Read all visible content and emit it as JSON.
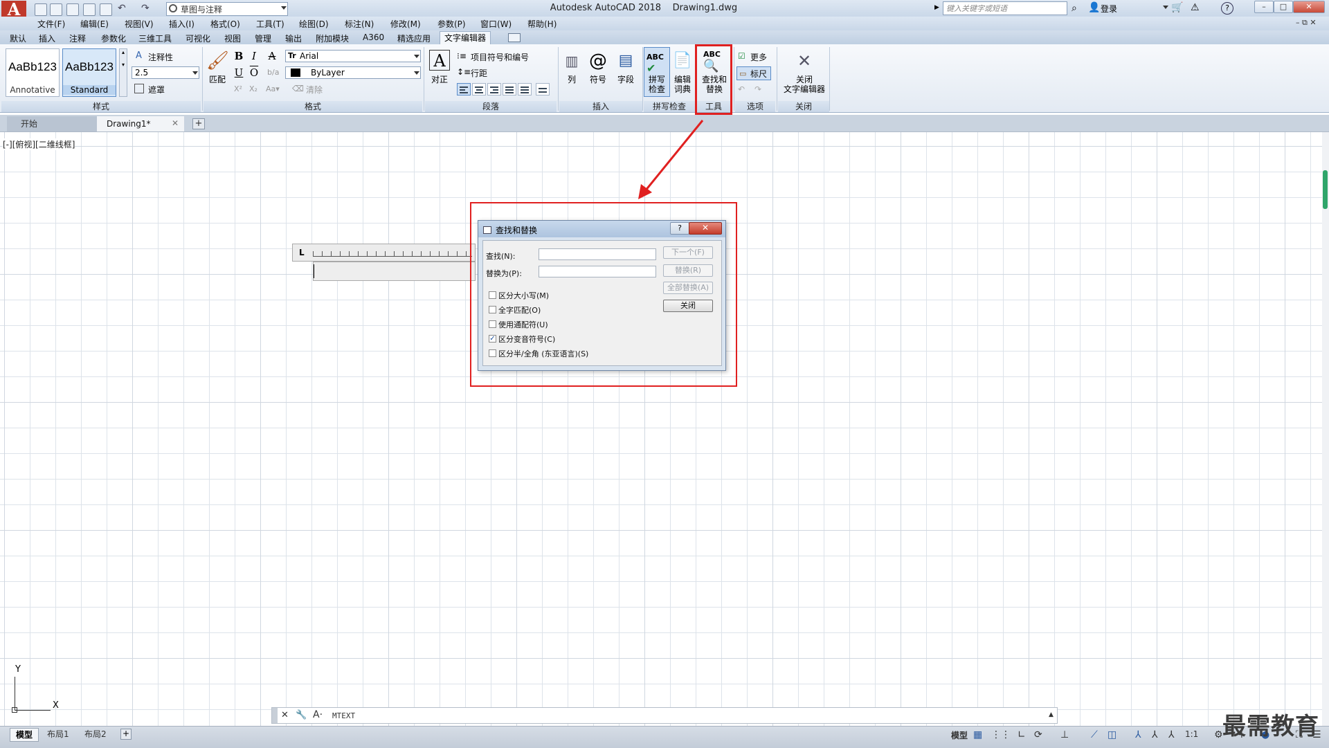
{
  "titlebar": {
    "workspace": "草图与注释",
    "app_title": "Autodesk AutoCAD 2018",
    "drawing_title": "Drawing1.dwg",
    "search_placeholder": "键入关键字或短语",
    "login_label": "登录",
    "help": "?"
  },
  "menu": [
    "文件(F)",
    "编辑(E)",
    "视图(V)",
    "插入(I)",
    "格式(O)",
    "工具(T)",
    "绘图(D)",
    "标注(N)",
    "修改(M)",
    "参数(P)",
    "窗口(W)",
    "帮助(H)"
  ],
  "ribbon_tabs": [
    "默认",
    "插入",
    "注释",
    "参数化",
    "三维工具",
    "可视化",
    "视图",
    "管理",
    "输出",
    "附加模块",
    "A360",
    "精选应用"
  ],
  "active_tab": "文字编辑器",
  "ribbon": {
    "style_panel": {
      "swatch1_text": "AaBb123",
      "swatch1_label": "Annotative",
      "swatch2_text": "AaBb123",
      "swatch2_label": "Standard",
      "annotative_label": "注释性",
      "text_height": "2.5",
      "mask_label": "遮罩",
      "title": "样式"
    },
    "format_panel": {
      "match_label": "匹配",
      "bold": "B",
      "italic": "I",
      "strike": "A",
      "underline": "U",
      "overline": "O",
      "font": "Arial",
      "color": "ByLayer",
      "clear_label": "清除",
      "title": "格式"
    },
    "paragraph_panel": {
      "justify_label": "对正",
      "bullets_label": "项目符号和编号",
      "line_spacing_label": "行距",
      "title": "段落"
    },
    "insert_panel": {
      "columns_label": "列",
      "symbol_label": "符号",
      "field_label": "字段",
      "title": "插入"
    },
    "spell_panel": {
      "spell_label_1": "拼写",
      "spell_label_2": "检查",
      "dict_label_1": "编辑",
      "dict_label_2": "词典",
      "title": "拼写检查"
    },
    "tools_panel": {
      "find_label_1": "查找和",
      "find_label_2": "替换",
      "title": "工具"
    },
    "options_panel": {
      "more_label": "更多",
      "ruler_label": "标尺",
      "title": "选项"
    },
    "close_panel": {
      "close_label_1": "关闭",
      "close_label_2": "文字编辑器",
      "title": "关闭"
    }
  },
  "file_tabs": {
    "start": "开始",
    "drawing": "Drawing1*"
  },
  "viewport_label": "[-][俯视][二维线框]",
  "dialog": {
    "title": "查找和替换",
    "find_label": "查找(N):",
    "replace_label": "替换为(P):",
    "find_value": "",
    "replace_value": "",
    "btn_next": "下一个(F)",
    "btn_replace": "替换(R)",
    "btn_replace_all": "全部替换(A)",
    "btn_close": "关闭",
    "options": [
      {
        "label": "区分大小写(M)",
        "checked": false
      },
      {
        "label": "全字匹配(O)",
        "checked": false
      },
      {
        "label": "使用通配符(U)",
        "checked": false
      },
      {
        "label": "区分变音符号(C)",
        "checked": true
      },
      {
        "label": "区分半/全角 (东亚语言)(S)",
        "checked": false
      }
    ]
  },
  "ucs": {
    "x": "X",
    "y": "Y"
  },
  "command_line": {
    "text": "MTEXT"
  },
  "statusbar": {
    "layouts": [
      "模型",
      "布局1",
      "布局2"
    ],
    "model_label": "模型",
    "scale": "1:1"
  },
  "watermark": "最需教育",
  "colors": {
    "highlight": "#e02020",
    "accent": "#2fa56a"
  }
}
